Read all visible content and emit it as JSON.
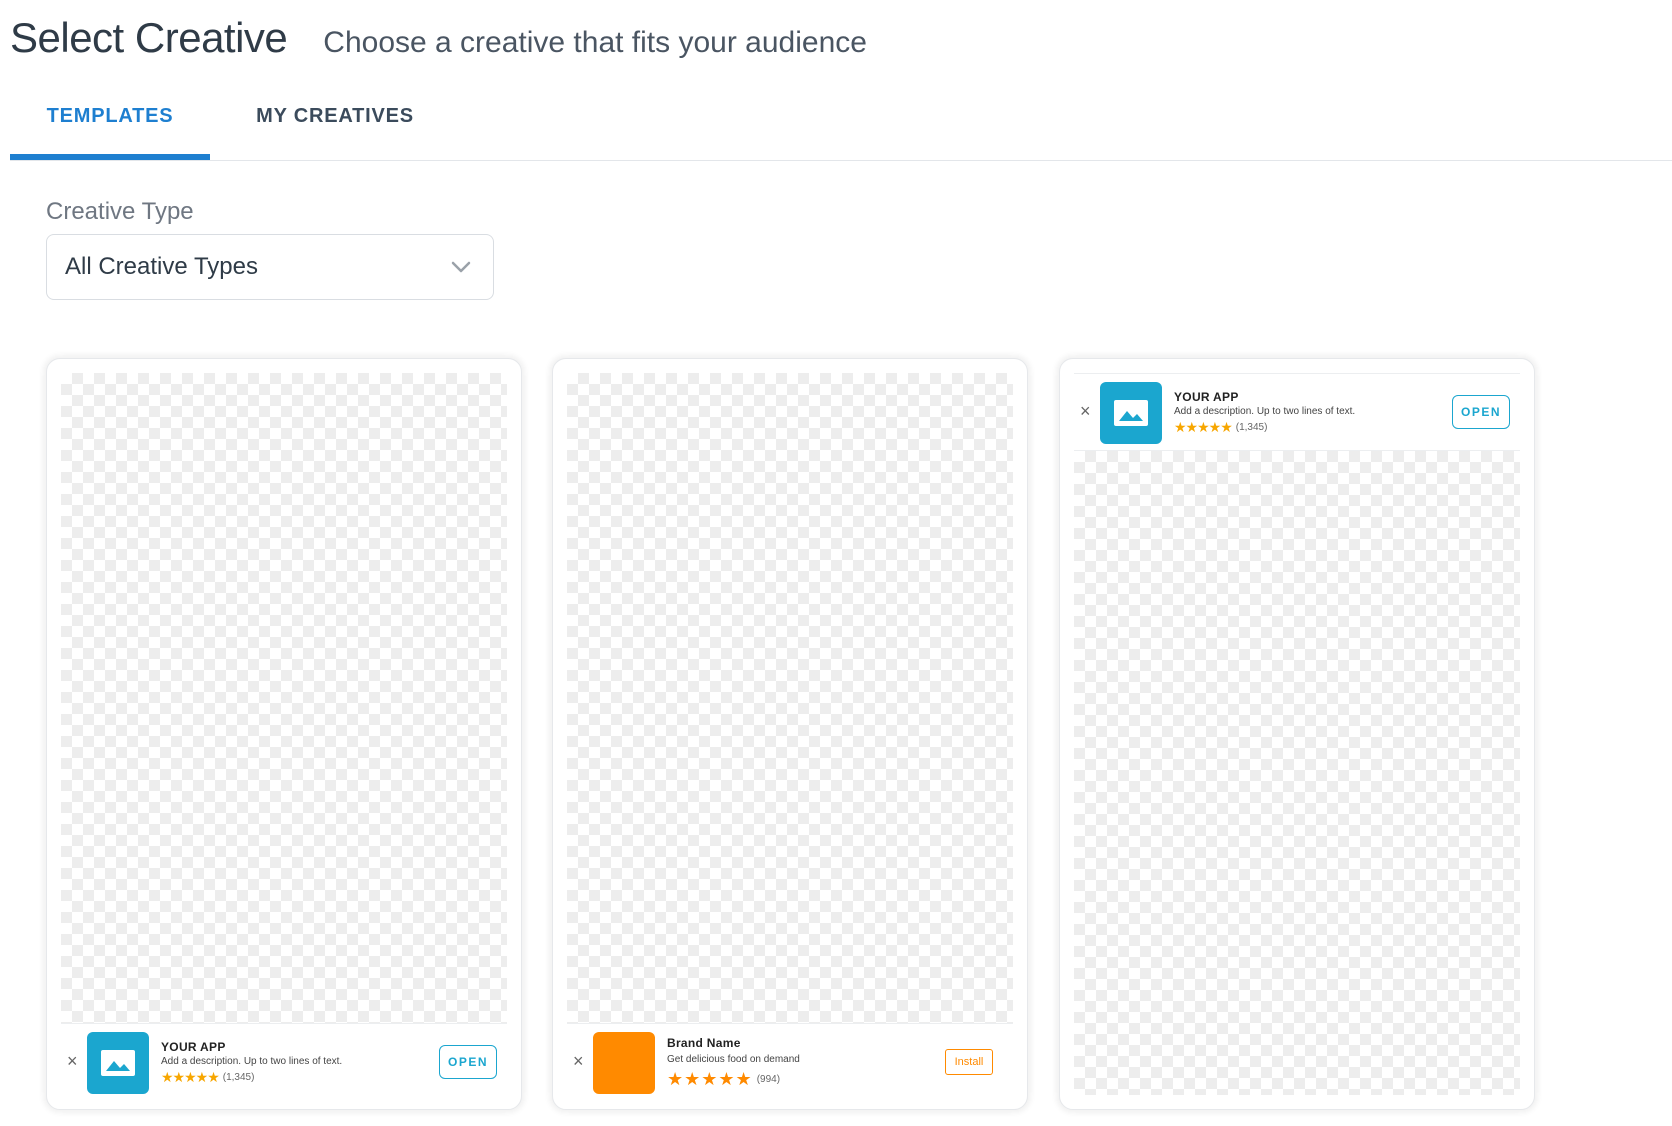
{
  "header": {
    "title": "Select Creative",
    "subtitle": "Choose a creative that fits your audience"
  },
  "tabs": [
    {
      "label": "TEMPLATES",
      "active": true
    },
    {
      "label": "MY CREATIVES",
      "active": false
    }
  ],
  "filter": {
    "label": "Creative Type",
    "value": "All Creative Types"
  },
  "colors": {
    "accent": "#1e7fd0",
    "app_icon_blue": "#1ba6cf",
    "brand_orange": "#ff8a00",
    "star_gold": "#f7a600"
  },
  "cards": [
    {
      "banner_position": "bottom",
      "app_name": "YOUR APP",
      "description": "Add a description. Up to two lines of text.",
      "stars": "★★★★★",
      "rating_count": "(1,345)",
      "cta": "OPEN",
      "icon": "image-icon"
    },
    {
      "banner_position": "bottom",
      "app_name": "Brand Name",
      "description": "Get delicious food on demand",
      "stars": "★★★★★",
      "rating_count": "(994)",
      "cta": "Install",
      "icon": "brand-logo"
    },
    {
      "banner_position": "top",
      "app_name": "YOUR APP",
      "description": "Add a description. Up to two lines of text.",
      "stars": "★★★★★",
      "rating_count": "(1,345)",
      "cta": "OPEN",
      "icon": "image-icon"
    }
  ],
  "close_glyph": "×"
}
